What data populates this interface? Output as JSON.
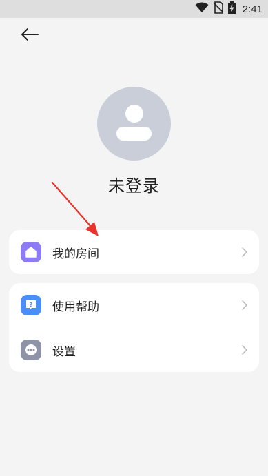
{
  "status_bar": {
    "time": "2:41",
    "icons": [
      "wifi-icon",
      "no-sim-icon",
      "battery-charging-icon"
    ]
  },
  "header": {
    "back_icon": "arrow-left-icon"
  },
  "profile": {
    "avatar_icon": "user-avatar-icon",
    "name": "未登录"
  },
  "menu": {
    "room": {
      "label": "我的房间",
      "icon": "home-icon",
      "icon_color": "#8d7cf3"
    },
    "help": {
      "label": "使用帮助",
      "icon": "help-icon",
      "icon_color": "#4a8ff7"
    },
    "settings": {
      "label": "设置",
      "icon": "more-dots-icon",
      "icon_color": "#8e93a8"
    }
  },
  "colors": {
    "background": "#f4f4f5",
    "card": "#ffffff",
    "avatar_bg": "#c9ced9",
    "annotation_arrow": "#e8322c"
  }
}
